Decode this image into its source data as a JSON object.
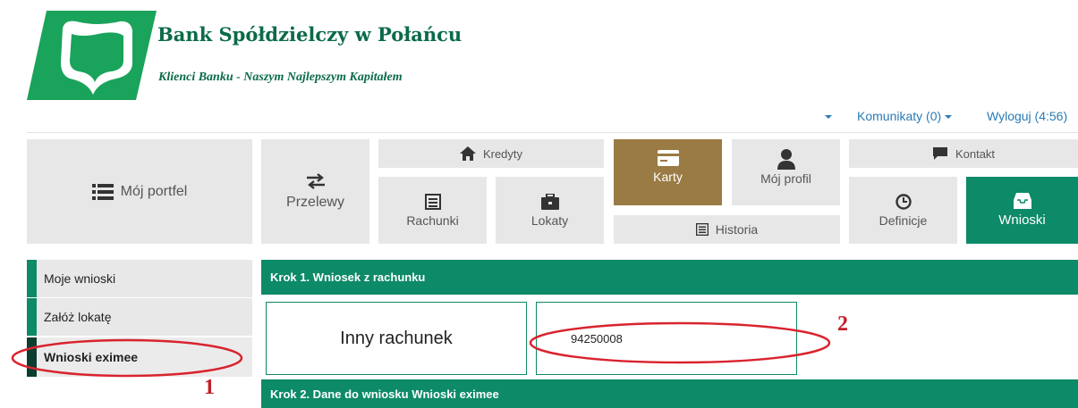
{
  "header": {
    "bank_name": "Bank Spółdzielczy w Połańcu",
    "slogan": "Klienci Banku - Naszym Najlepszym Kapitałem",
    "brand_green": "#0d8a67",
    "logo_icon": "bank-shield-logo"
  },
  "toplinks": {
    "messages": "Komunikaty (0)",
    "logout": "Wyloguj (4:56)"
  },
  "nav": {
    "portfolio": "Mój portfel",
    "transfers": "Przelewy",
    "loans": "Kredyty",
    "accounts": "Rachunki",
    "deposits": "Lokaty",
    "cards": "Karty",
    "profile": "Mój profil",
    "history": "Historia",
    "contact": "Kontakt",
    "definitions": "Definicje",
    "applications": "Wnioski",
    "cards_color": "#9a7b44"
  },
  "sidebar": {
    "items": [
      {
        "label": "Moje wnioski"
      },
      {
        "label": "Załóż lokatę"
      },
      {
        "label": "Wnioski eximee"
      }
    ]
  },
  "content": {
    "step1_title": "Krok 1. Wniosek z rachunku",
    "other_account": "Inny rachunek",
    "account_number": "94250008",
    "step2_title": "Krok 2. Dane do wniosku Wnioski eximee"
  },
  "annotations": {
    "marker1": "1",
    "marker2": "2",
    "marker_color": "#d9232e"
  }
}
